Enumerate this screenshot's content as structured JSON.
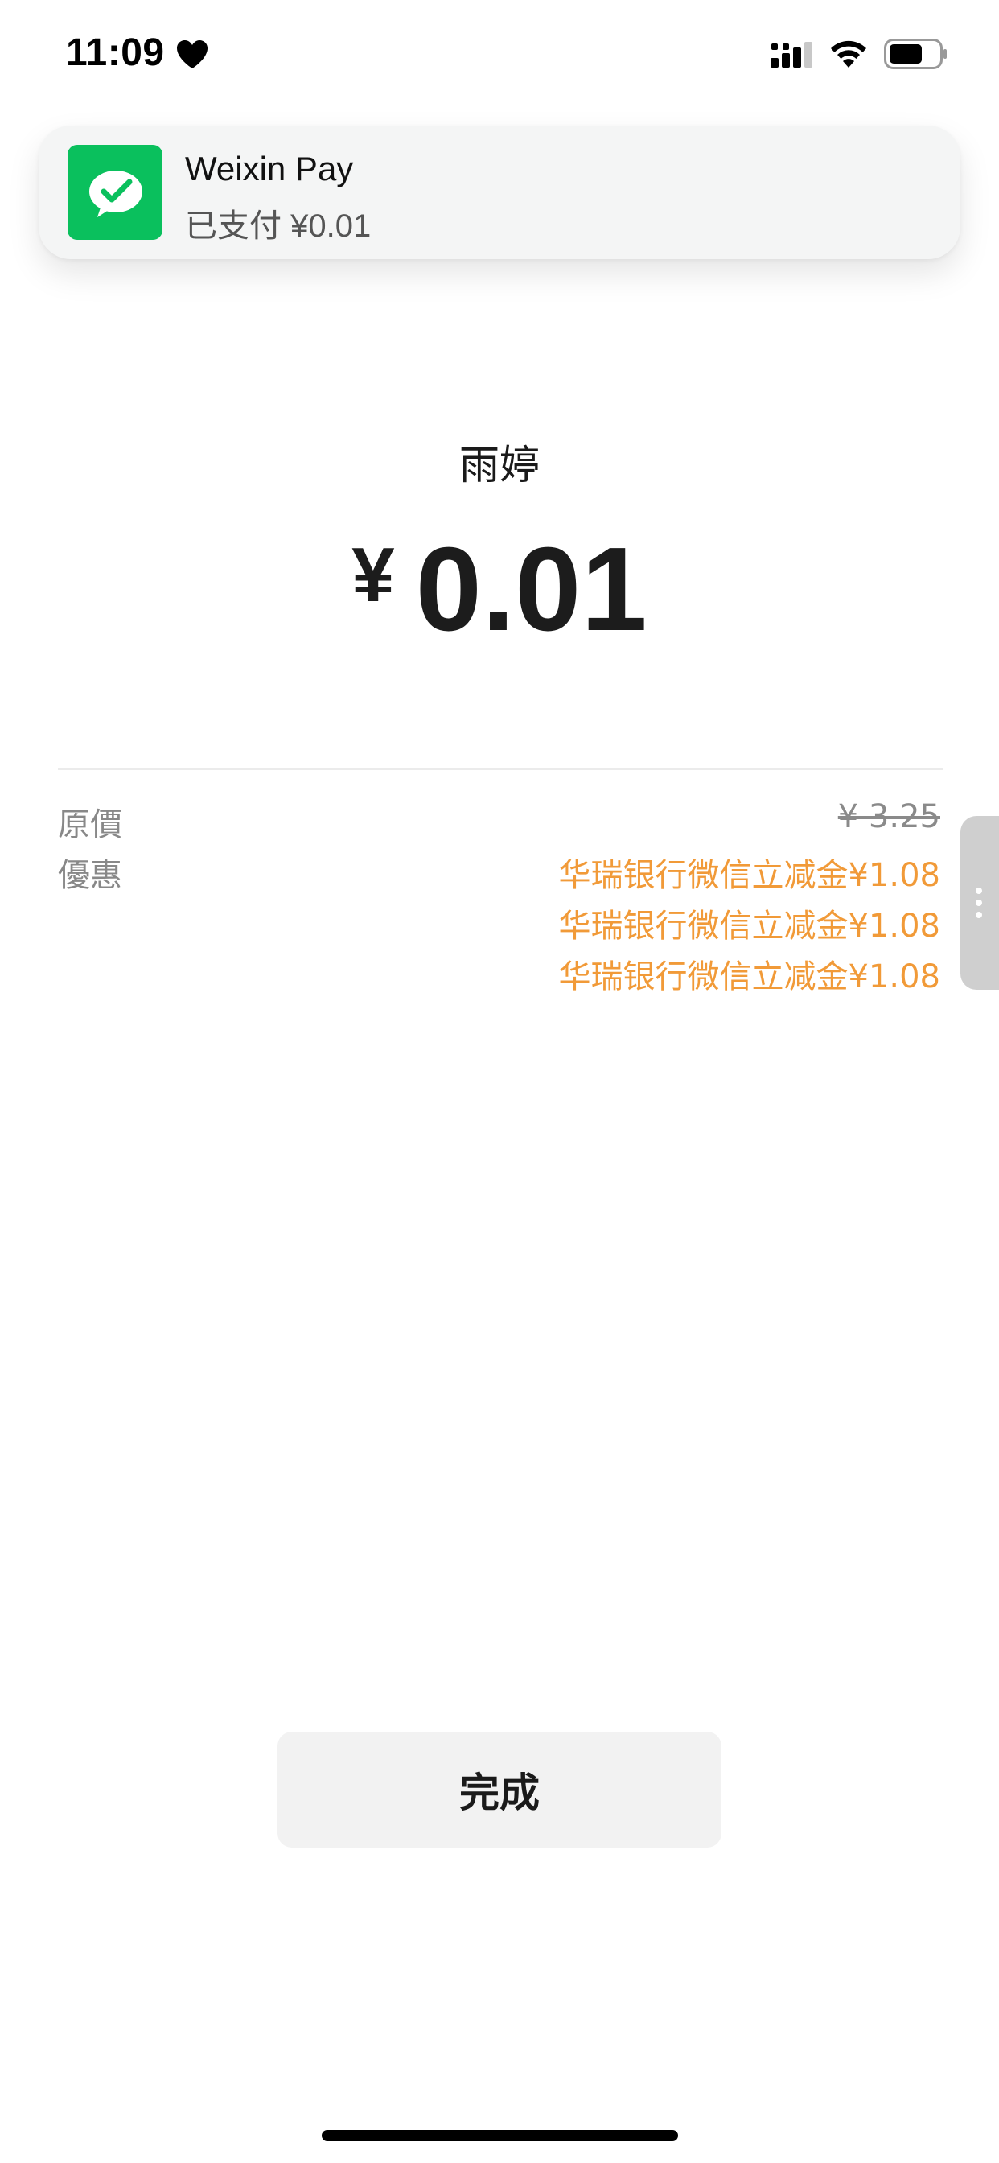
{
  "status_bar": {
    "time": "11:09",
    "icons": [
      "heart-icon",
      "signal-icon",
      "wifi-icon",
      "battery-icon"
    ]
  },
  "notification": {
    "app_icon": "wechat-icon",
    "title": "Weixin Pay",
    "body": "已支付 ¥0.01",
    "accent_color": "#0ac05d"
  },
  "payment": {
    "payee": "雨婷",
    "currency_symbol": "¥",
    "amount": "0.01"
  },
  "details": {
    "original_price_label": "原價",
    "original_price_value": "¥ 3.25",
    "discount_label": "優惠",
    "discounts": [
      "华瑞银行微信立减金¥1.08",
      "华瑞银行微信立减金¥1.08",
      "华瑞银行微信立减金¥1.08"
    ],
    "discount_color": "#f19a38"
  },
  "actions": {
    "done_label": "完成"
  },
  "side_handle": {
    "icon": "more-vertical-icon"
  }
}
